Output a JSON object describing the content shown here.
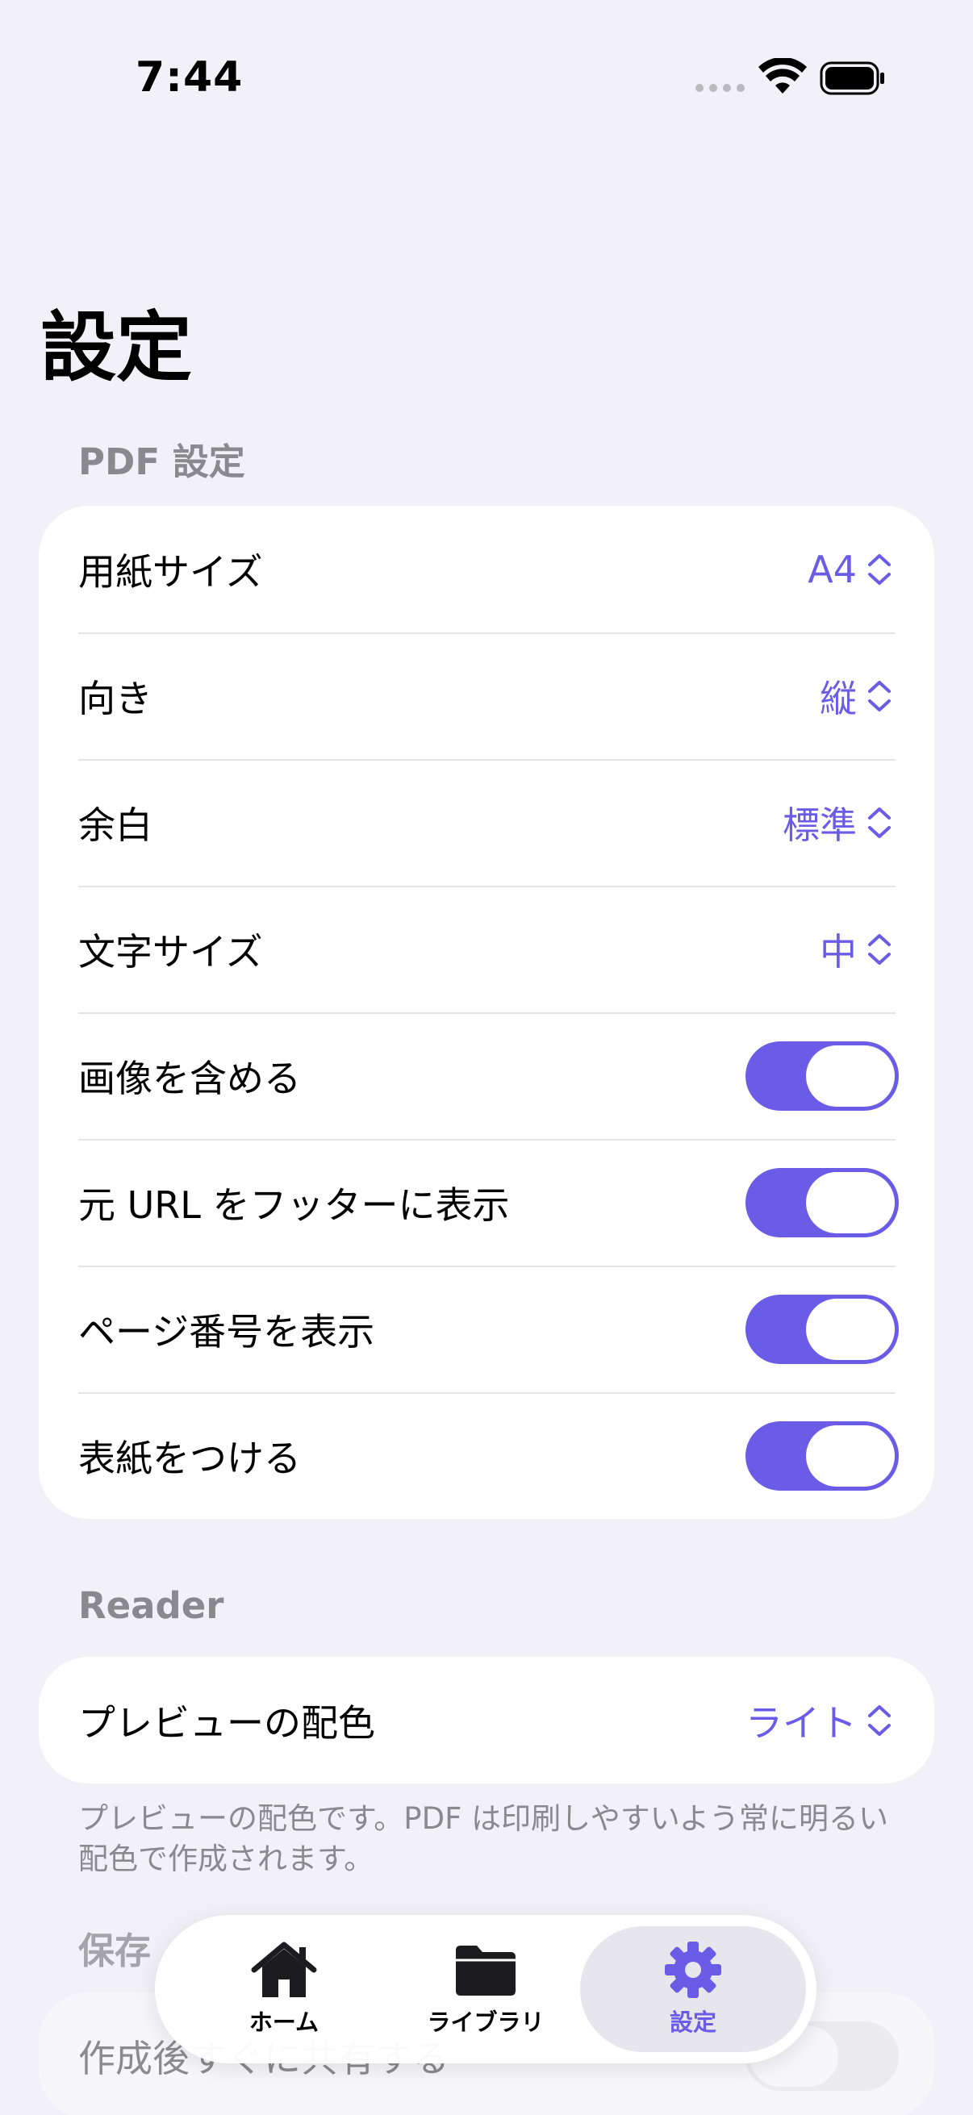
{
  "status_bar": {
    "time": "7:44"
  },
  "page_title": "設定",
  "pdf_section": {
    "header": "PDF 設定",
    "rows": [
      {
        "label": "用紙サイズ",
        "value": "A4"
      },
      {
        "label": "向き",
        "value": "縦"
      },
      {
        "label": "余白",
        "value": "標準"
      },
      {
        "label": "文字サイズ",
        "value": "中"
      },
      {
        "label": "画像を含める",
        "toggle": true
      },
      {
        "label": "元 URL をフッターに表示",
        "toggle": true
      },
      {
        "label": "ページ番号を表示",
        "toggle": true
      },
      {
        "label": "表紙をつける",
        "toggle": true
      }
    ]
  },
  "reader_section": {
    "header": "Reader",
    "rows": [
      {
        "label": "プレビューの配色",
        "value": "ライト"
      }
    ],
    "footer": "プレビューの配色です。PDF は印刷しやすいよう常に明るい配色で作成されます。"
  },
  "save_section": {
    "header": "保存",
    "rows": [
      {
        "label": "作成後すぐに共有する",
        "toggle": false
      }
    ]
  },
  "tab_bar": {
    "tabs": [
      {
        "label": "ホーム",
        "icon": "house-icon"
      },
      {
        "label": "ライブラリ",
        "icon": "folder-icon"
      },
      {
        "label": "設定",
        "icon": "gear-icon",
        "selected": true
      }
    ]
  },
  "colors": {
    "accent": "#6b5ce7",
    "background": "#f2f1f7",
    "card": "#ffffff",
    "secondary_text": "#8a8a8e"
  }
}
